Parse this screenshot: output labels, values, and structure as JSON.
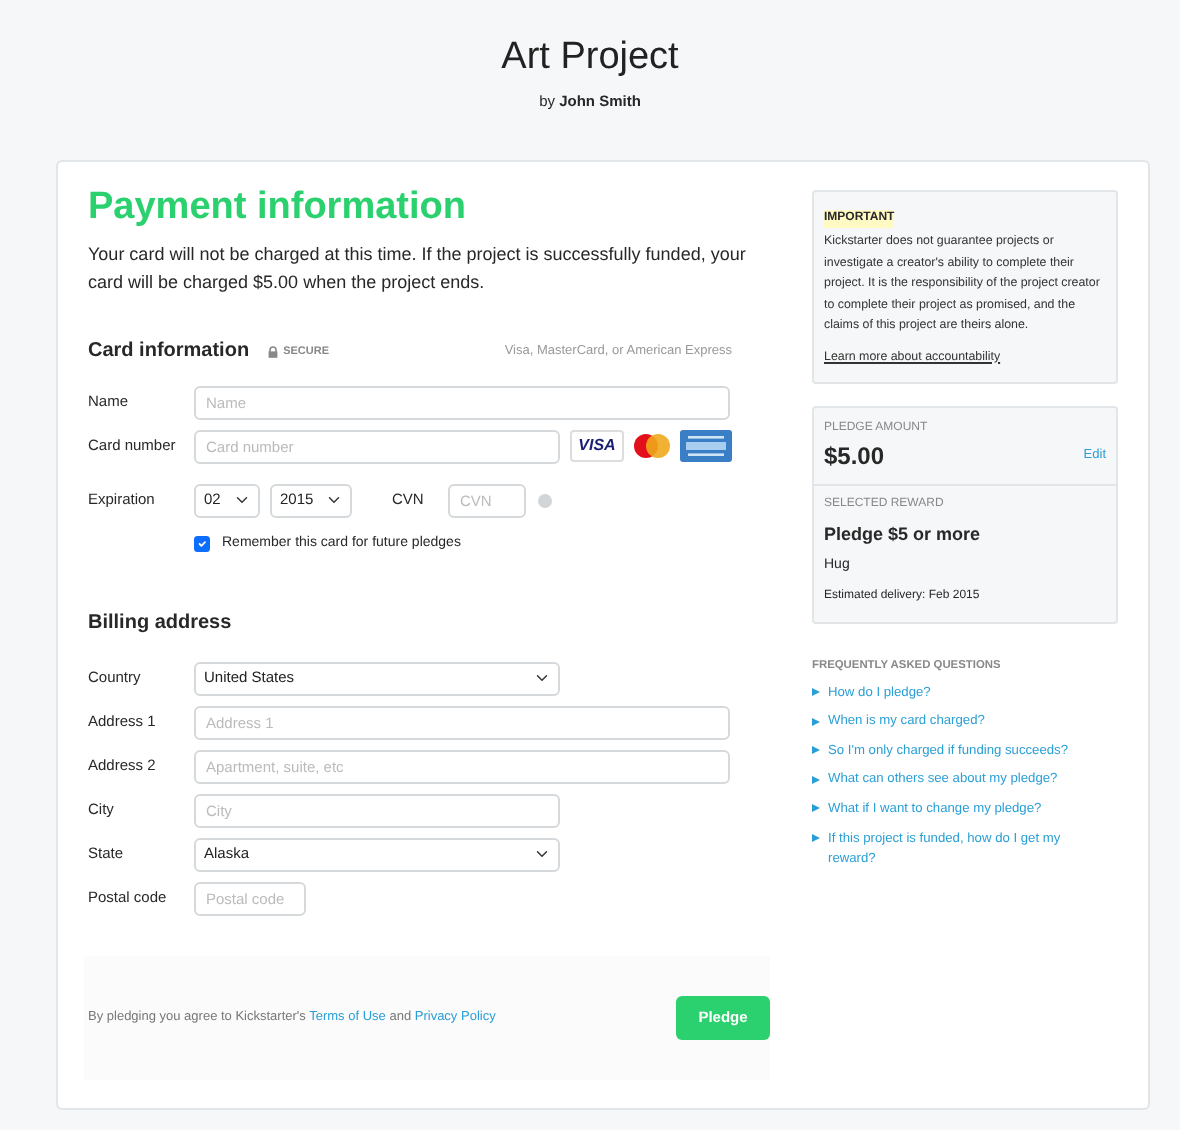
{
  "header": {
    "title": "Art Project",
    "by": "by",
    "author": "John Smith"
  },
  "payment": {
    "heading": "Payment information",
    "note": "Your card will not be charged at this time. If the project is successfully funded, your card will be charged $5.00 when the project ends."
  },
  "card_info": {
    "heading": "Card information",
    "secure": "SECURE",
    "accepted": "Visa, MasterCard, or American Express",
    "visa_logo": "VISA",
    "fields": [
      {
        "kind": "input",
        "label": "Name",
        "placeholder": "Name"
      },
      {
        "kind": "card",
        "label": "Card number",
        "placeholder": "Card number"
      },
      {
        "kind": "expiration",
        "label": "Expiration",
        "month": "02",
        "year": "2015",
        "cvn_label": "CVN",
        "cvn_placeholder": "CVN"
      }
    ],
    "remember": {
      "label": "Remember this card for future pledges",
      "checked": true
    }
  },
  "billing": {
    "heading": "Billing address",
    "fields": [
      {
        "kind": "select",
        "label": "Country",
        "value": "United States"
      },
      {
        "kind": "input",
        "label": "Address 1",
        "placeholder": "Address 1"
      },
      {
        "kind": "input",
        "label": "Address 2",
        "placeholder": "Apartment, suite, etc"
      },
      {
        "kind": "input",
        "label": "City",
        "placeholder": "City"
      },
      {
        "kind": "select",
        "label": "State",
        "value": "Alaska"
      },
      {
        "kind": "input",
        "label": "Postal code",
        "placeholder": "Postal code"
      }
    ]
  },
  "footer": {
    "agreement": "By pledging you agree to Kickstarter's ",
    "terms_link": "Terms of Use",
    "and": " and ",
    "privacy_link": "Privacy Policy",
    "button": "Pledge"
  },
  "sidebar": {
    "important": {
      "title": "IMPORTANT",
      "body": "Kickstarter does not guarantee projects or investigate a creator's ability to complete their project. It is the responsibility of the project creator to complete their project as promised, and the claims of this project are theirs alone.",
      "link": "Learn more about accountability"
    },
    "pledge": {
      "label": "PLEDGE AMOUNT",
      "amount": "$5.00",
      "edit": "Edit"
    },
    "reward": {
      "label": "SELECTED REWARD",
      "title": "Pledge $5 or more",
      "description": "Hug",
      "delivery": "Estimated delivery: Feb 2015"
    },
    "faq": {
      "heading": "FREQUENTLY ASKED QUESTIONS",
      "items": [
        "How do I pledge?",
        "When is my card charged?",
        "So I'm only charged if funding succeeds?",
        "What can others see about my pledge?",
        "What if I want to change my pledge?",
        "If this project is funded, how do I get my reward?"
      ]
    }
  }
}
